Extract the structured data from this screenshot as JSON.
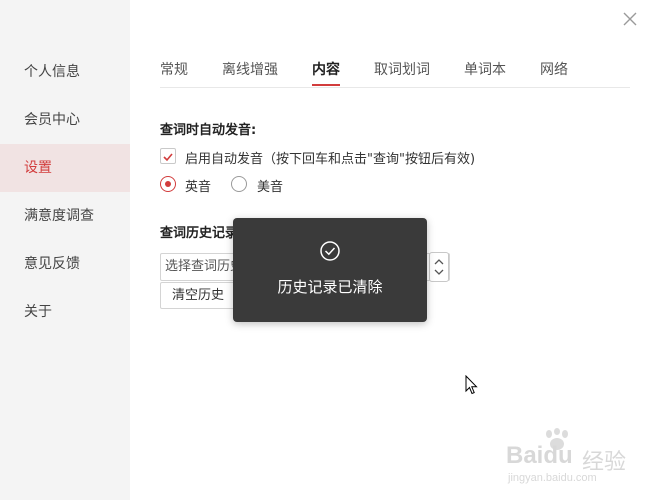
{
  "sidebar": {
    "items": [
      {
        "label": "个人信息",
        "active": false
      },
      {
        "label": "会员中心",
        "active": false
      },
      {
        "label": "设置",
        "active": true
      },
      {
        "label": "满意度调查",
        "active": false
      },
      {
        "label": "意见反馈",
        "active": false
      },
      {
        "label": "关于",
        "active": false
      }
    ]
  },
  "tabs": [
    {
      "label": "常规",
      "active": false
    },
    {
      "label": "离线增强",
      "active": false
    },
    {
      "label": "内容",
      "active": true
    },
    {
      "label": "取词划词",
      "active": false
    },
    {
      "label": "单词本",
      "active": false
    },
    {
      "label": "网络",
      "active": false
    }
  ],
  "pronunciation": {
    "title": "查词时自动发音:",
    "checkbox_label": "启用自动发音（按下回车和点击\"查询\"按钮后有效)",
    "checked": true,
    "radio_uk": "英音",
    "radio_us": "美音",
    "selected": "英音"
  },
  "history": {
    "title": "查词历史记录",
    "select_placeholder": "选择查词历史",
    "clear_button": "清空历史"
  },
  "toast": {
    "icon": "check-circle-icon",
    "message": "历史记录已清除"
  },
  "colors": {
    "accent": "#d23c3c",
    "sidebar_bg": "#f4f4f4",
    "active_item_bg": "#f1e3e3",
    "toast_bg": "#3a3a3a"
  },
  "watermark": {
    "brand": "Baidu",
    "cn": "经验",
    "url": "jingyan.baidu.com"
  }
}
